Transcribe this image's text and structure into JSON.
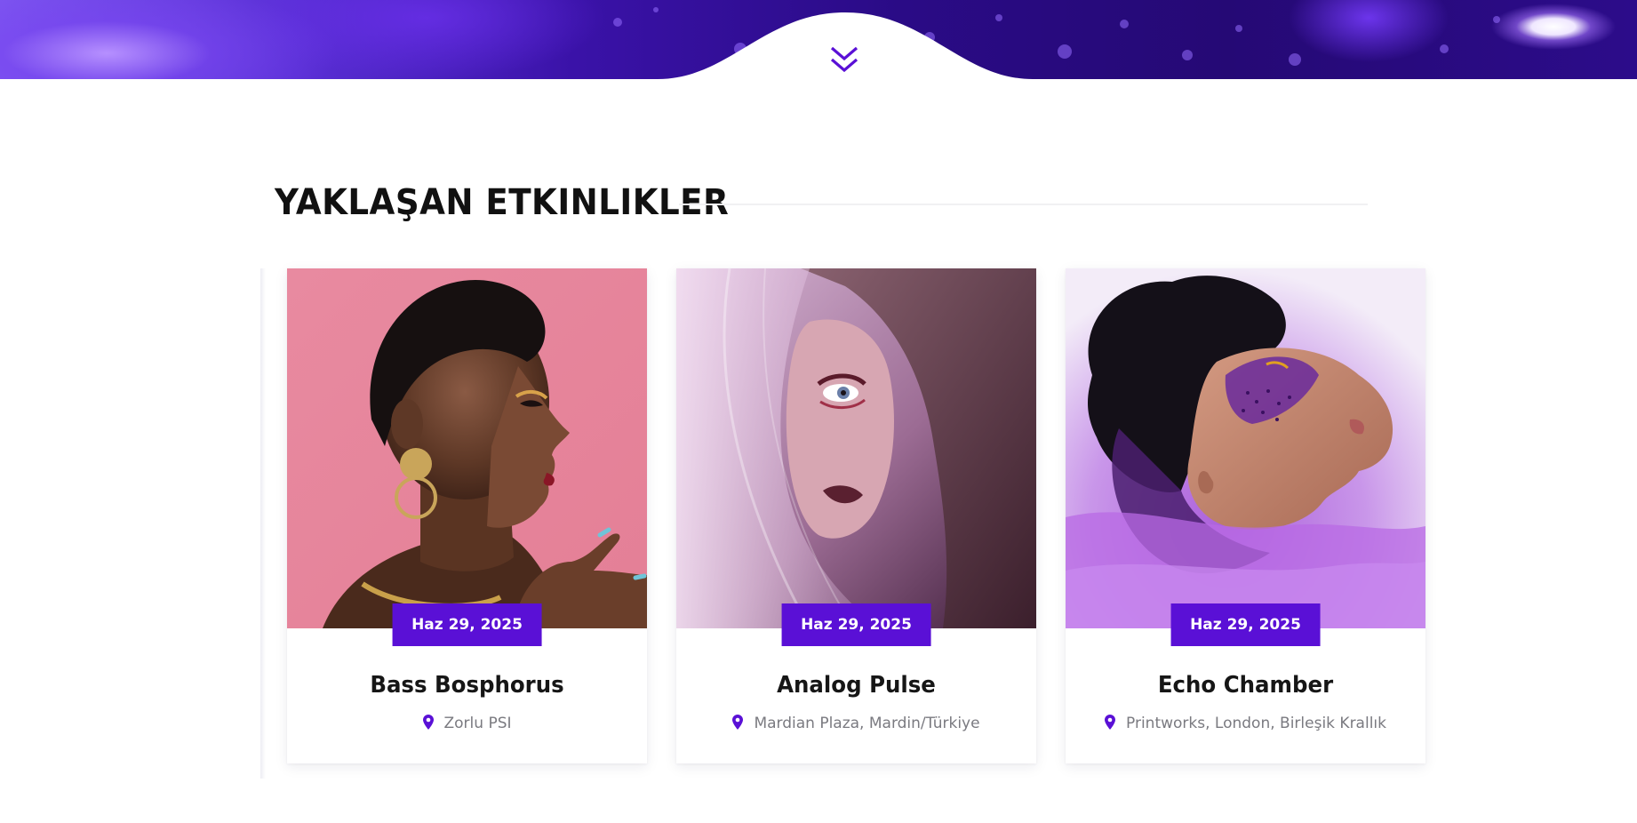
{
  "hero": {
    "scroll_icon": "chevron-double-down-icon",
    "accent_color": "#5a10d6"
  },
  "section": {
    "title": "YAKLAŞAN ETKINLIKLER"
  },
  "events": [
    {
      "title": "Bass Bosphorus",
      "date": "Haz 29, 2025",
      "location": "Zorlu PSI",
      "image": "woman-profile-pink-background"
    },
    {
      "title": "Analog Pulse",
      "date": "Haz 29, 2025",
      "location": "Mardian Plaza, Mardin/Türkiye",
      "image": "woman-behind-veil-mauve"
    },
    {
      "title": "Echo Chamber",
      "date": "Haz 29, 2025",
      "location": "Printworks, London, Birleşik Krallık",
      "image": "woman-purple-smoke-glitter"
    }
  ],
  "colors": {
    "badge": "#5a10d6",
    "pin": "#5a10d6",
    "title_text": "#111111",
    "location_text": "#7a7a80"
  }
}
